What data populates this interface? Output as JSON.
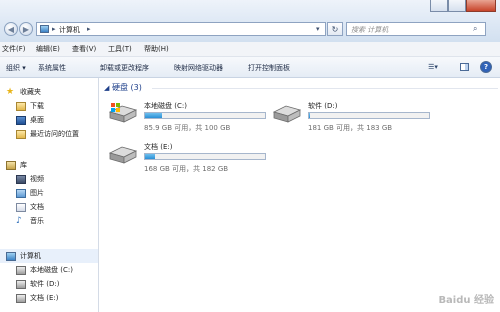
{
  "window": {
    "address_path": [
      "计算机"
    ],
    "search_placeholder": "搜索 计算机"
  },
  "menu": {
    "items": [
      "文件(F)",
      "编辑(E)",
      "查看(V)",
      "工具(T)",
      "帮助(H)"
    ]
  },
  "toolbar": {
    "items": [
      "组织",
      "系统属性",
      "卸载或更改程序",
      "映射网络驱动器",
      "打开控制面板"
    ]
  },
  "sidebar": {
    "favorites": {
      "label": "收藏夹",
      "items": [
        "下载",
        "桌面",
        "最近访问的位置"
      ]
    },
    "libraries": {
      "label": "库",
      "items": [
        "视频",
        "图片",
        "文档",
        "音乐"
      ]
    },
    "computer": {
      "label": "计算机",
      "items": [
        "本地磁盘 (C:)",
        "软件 (D:)",
        "文档 (E:)"
      ]
    }
  },
  "content": {
    "group_title": "硬盘 (3)",
    "drives": [
      {
        "name": "本地磁盘 (C:)",
        "space": "85.9 GB 可用，共 100 GB",
        "used_fraction": 0.14
      },
      {
        "name": "软件 (D:)",
        "space": "181 GB 可用，共 183 GB",
        "used_fraction": 0.01
      },
      {
        "name": "文档 (E:)",
        "space": "168 GB 可用，共 182 GB",
        "used_fraction": 0.08
      }
    ]
  },
  "watermark": {
    "text": "Baidu 经验"
  },
  "colors": {
    "accent": "#1e3f8a",
    "bar_fill": "#2a8fd6",
    "chrome": "#dce7f4"
  }
}
